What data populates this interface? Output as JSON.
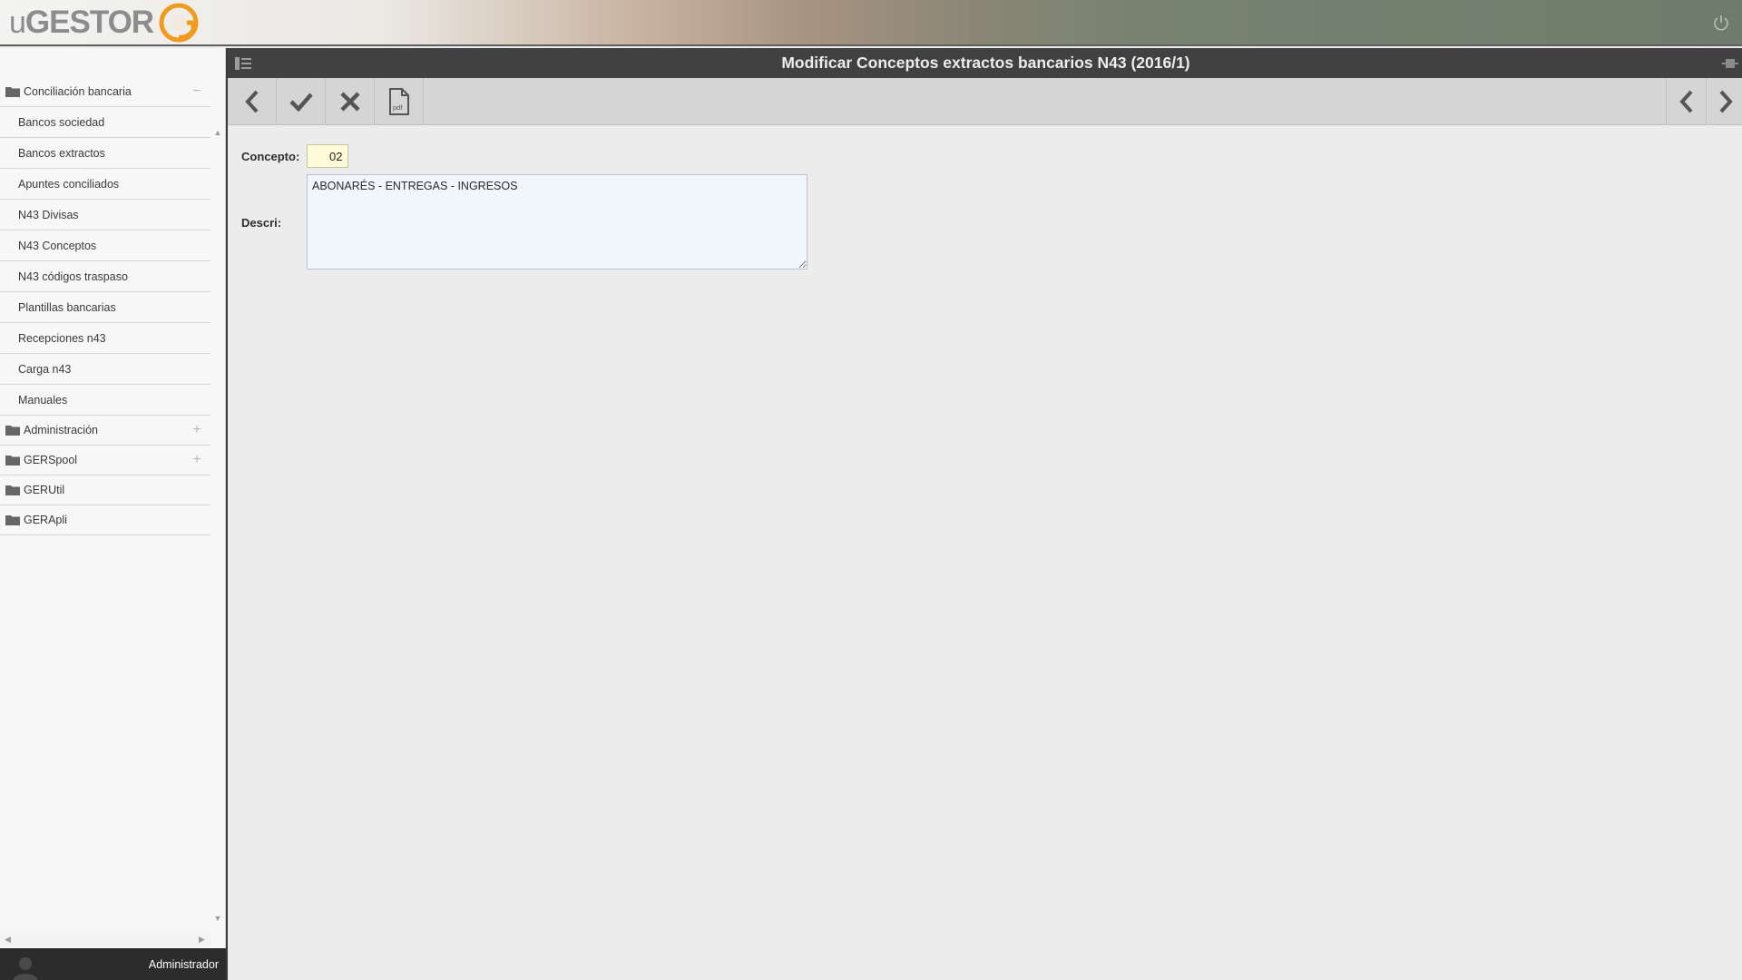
{
  "app": {
    "logo_text_u": "u",
    "logo_text_main": "GESTOR",
    "accent_color": "#f09a1e"
  },
  "page": {
    "title": "Modificar Conceptos extractos bancarios N43 (2016/1)"
  },
  "sidebar": {
    "groups": [
      {
        "label": "Conciliación bancaria",
        "expanded": true,
        "toggle": "−",
        "children": [
          "Bancos sociedad",
          "Bancos extractos",
          "Apuntes conciliados",
          "N43 Divisas",
          "N43 Conceptos",
          "N43 códigos traspaso",
          "Plantillas bancarias",
          "Recepciones n43",
          "Carga n43",
          "Manuales"
        ]
      },
      {
        "label": "Administración",
        "expanded": false,
        "toggle": "+"
      },
      {
        "label": "GERSpool",
        "expanded": false,
        "toggle": "+"
      },
      {
        "label": "GERUtil",
        "expanded": false,
        "toggle": ""
      },
      {
        "label": "GERApli",
        "expanded": false,
        "toggle": ""
      }
    ]
  },
  "user": {
    "name": "Administrador"
  },
  "toolbar": {
    "buttons": [
      {
        "name": "back-button",
        "icon": "chevron-left-icon"
      },
      {
        "name": "save-button",
        "icon": "check-icon"
      },
      {
        "name": "cancel-button",
        "icon": "close-icon"
      },
      {
        "name": "pdf-button",
        "icon": "pdf-icon",
        "icon_text": "pdf"
      }
    ],
    "nav_buttons": [
      {
        "name": "previous-record-button",
        "icon": "chevron-left-icon"
      },
      {
        "name": "next-record-button",
        "icon": "chevron-right-icon"
      }
    ]
  },
  "form": {
    "concepto_label": "Concepto:",
    "concepto_value": "02",
    "descri_label": "Descri:",
    "descri_value": "ABONARÉS - ENTREGAS - INGRESOS"
  }
}
